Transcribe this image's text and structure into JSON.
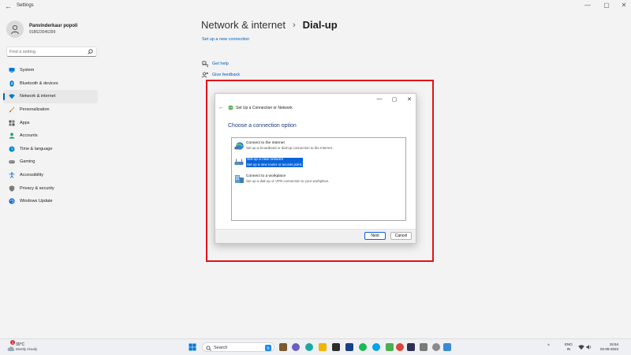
{
  "window": {
    "title": "Settings",
    "controls": [
      "—",
      "▢",
      "✕"
    ]
  },
  "profile": {
    "name": "Panvinderkaur popoli",
    "phone": "918623046399"
  },
  "search": {
    "placeholder": "Find a setting"
  },
  "sidebar": {
    "items": [
      {
        "label": "System",
        "icon": "system-icon",
        "color": "#0078d4"
      },
      {
        "label": "Bluetooth & devices",
        "icon": "bluetooth-icon",
        "color": "#0078d4"
      },
      {
        "label": "Network & internet",
        "icon": "wifi-icon",
        "color": "#0078d4",
        "selected": true
      },
      {
        "label": "Personalization",
        "icon": "brush-icon",
        "color": "#e07a1f"
      },
      {
        "label": "Apps",
        "icon": "apps-icon",
        "color": "#555555"
      },
      {
        "label": "Accounts",
        "icon": "person-icon",
        "color": "#22a06b"
      },
      {
        "label": "Time & language",
        "icon": "globe-clock-icon",
        "color": "#0a84c8"
      },
      {
        "label": "Gaming",
        "icon": "gamepad-icon",
        "color": "#777777"
      },
      {
        "label": "Accessibility",
        "icon": "accessibility-icon",
        "color": "#1f6fd6"
      },
      {
        "label": "Privacy & security",
        "icon": "shield-icon",
        "color": "#7a7a7a"
      },
      {
        "label": "Windows Update",
        "icon": "update-icon",
        "color": "#0a6ad4"
      }
    ]
  },
  "main": {
    "breadcrumb_parent": "Network & internet",
    "breadcrumb_separator": "›",
    "breadcrumb_current": "Dial-up",
    "setup_link": "Set up a new connection",
    "get_help": "Get help",
    "give_feedback": "Give feedback"
  },
  "dialog": {
    "title": "Set Up a Connection or Network",
    "heading": "Choose a connection option",
    "options": [
      {
        "title": "Connect to the Internet",
        "desc": "Set up a broadband or dial-up connection to the Internet.",
        "selected": false
      },
      {
        "title": "Set up a new network",
        "desc": "Set up a new router or access point.",
        "selected": true
      },
      {
        "title": "Connect to a workplace",
        "desc": "Set up a dial-up or VPN connection to your workplace.",
        "selected": false
      }
    ],
    "next_label": "Next",
    "cancel_label": "Cancel"
  },
  "taskbar": {
    "weather_temp": "30°C",
    "weather_badge": "1",
    "weather_desc": "Mostly cloudy",
    "search_label": "Search",
    "language_line1": "ENG",
    "language_line2": "IN",
    "time": "15:54",
    "date": "02-08-2023"
  },
  "colors": {
    "accent": "#005fb8",
    "highlight_box": "#e0131b",
    "selection": "#0a64d9"
  }
}
